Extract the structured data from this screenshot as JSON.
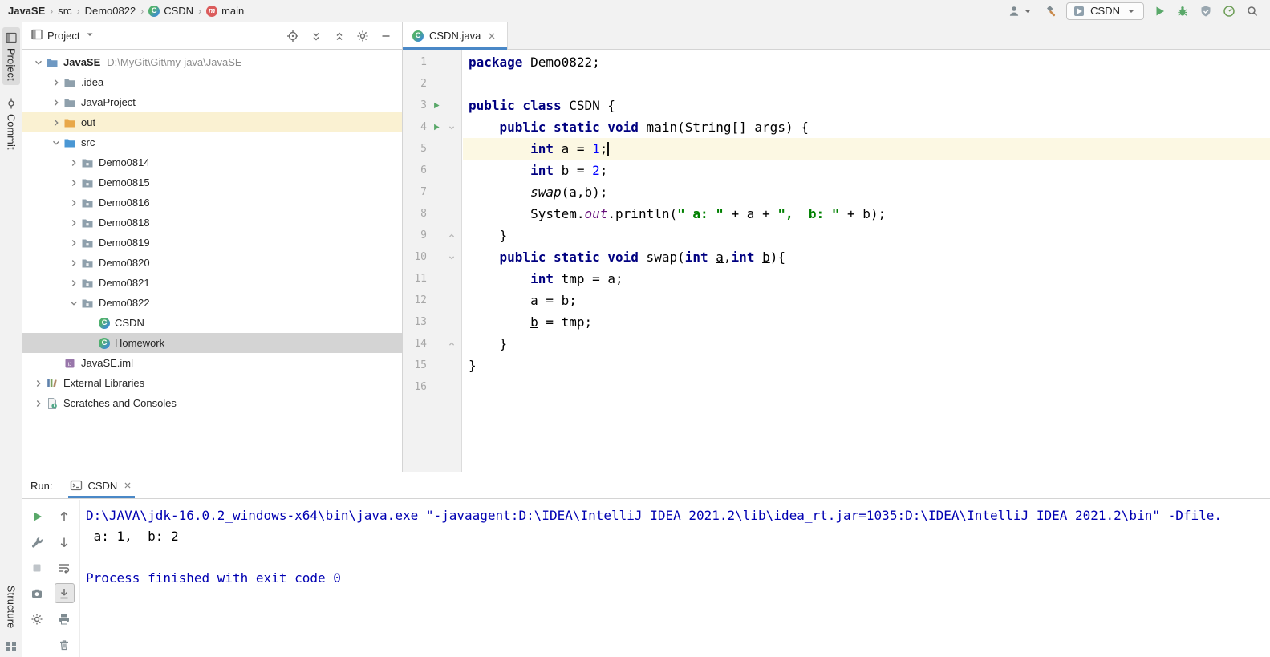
{
  "colors": {
    "accent_blue": "#4A88C7",
    "keyword": "#000080",
    "number": "#0000FF",
    "string": "#008000",
    "static_field": "#660E7A",
    "console_system": "#0000B2",
    "run_green": "#59A869",
    "caret_line": "#FCF8E3",
    "selection_gray": "#D4D4D4",
    "excluded_row_yellow": "#FAF1D2"
  },
  "breadcrumbs": {
    "separator": "›",
    "items": [
      {
        "label": "JavaSE",
        "bold": true
      },
      {
        "label": "src"
      },
      {
        "label": "Demo0822"
      },
      {
        "label": "CSDN",
        "icon": "class"
      },
      {
        "label": "main",
        "icon": "method"
      }
    ]
  },
  "top_toolbar": {
    "left_icons": [
      "user",
      "hammer"
    ],
    "run_config": {
      "label": "CSDN",
      "icon": "app-config"
    },
    "action_icons": [
      "run",
      "debug",
      "coverage",
      "profiler",
      "search"
    ]
  },
  "left_stripe": {
    "tabs": [
      {
        "label": "Project",
        "icon": "tool-window",
        "active": true
      },
      {
        "label": "Commit",
        "icon": "commit"
      }
    ],
    "bottom_tab": {
      "label": "Structure"
    }
  },
  "project_panel": {
    "title": "Project",
    "header_icons": [
      "target",
      "expand-all",
      "collapse-all",
      "gear",
      "minimize"
    ],
    "tree": [
      {
        "label": "JavaSE",
        "path": "D:\\MyGit\\Git\\my-java\\JavaSE",
        "level": 0,
        "chevron": "down",
        "icon": "folder-root",
        "bold": true
      },
      {
        "label": ".idea",
        "level": 1,
        "chevron": "right",
        "icon": "folder"
      },
      {
        "label": "JavaProject",
        "level": 1,
        "chevron": "right",
        "icon": "folder"
      },
      {
        "label": "out",
        "level": 1,
        "chevron": "right",
        "icon": "folder-out",
        "state": "highlighted"
      },
      {
        "label": "src",
        "level": 1,
        "chevron": "down",
        "icon": "folder-src"
      },
      {
        "label": "Demo0814",
        "level": 2,
        "chevron": "right",
        "icon": "package"
      },
      {
        "label": "Demo0815",
        "level": 2,
        "chevron": "right",
        "icon": "package"
      },
      {
        "label": "Demo0816",
        "level": 2,
        "chevron": "right",
        "icon": "package"
      },
      {
        "label": "Demo0818",
        "level": 2,
        "chevron": "right",
        "icon": "package"
      },
      {
        "label": "Demo0819",
        "level": 2,
        "chevron": "right",
        "icon": "package"
      },
      {
        "label": "Demo0820",
        "level": 2,
        "chevron": "right",
        "icon": "package"
      },
      {
        "label": "Demo0821",
        "level": 2,
        "chevron": "right",
        "icon": "package"
      },
      {
        "label": "Demo0822",
        "level": 2,
        "chevron": "down",
        "icon": "package"
      },
      {
        "label": "CSDN",
        "level": 3,
        "icon": "class"
      },
      {
        "label": "Homework",
        "level": 3,
        "icon": "class",
        "state": "selected"
      },
      {
        "label": "JavaSE.iml",
        "level": 1,
        "icon": "file-iml"
      },
      {
        "label": "External Libraries",
        "level": 0,
        "chevron": "right",
        "icon": "library"
      },
      {
        "label": "Scratches and Consoles",
        "level": 0,
        "chevron": "right",
        "icon": "scratches"
      }
    ]
  },
  "editor": {
    "tab": {
      "label": "CSDN.java",
      "icon": "class"
    },
    "lines": [
      {
        "n": 1,
        "seg": [
          {
            "t": "package",
            "c": "k"
          },
          {
            "t": " Demo0822;",
            "c": "p"
          }
        ]
      },
      {
        "n": 2,
        "seg": []
      },
      {
        "n": 3,
        "run": true,
        "seg": [
          {
            "t": "public class",
            "c": "k"
          },
          {
            "t": " CSDN {",
            "c": "p"
          }
        ]
      },
      {
        "n": 4,
        "run": true,
        "fold": "start",
        "seg": [
          {
            "t": "    ",
            "c": "p"
          },
          {
            "t": "public static void",
            "c": "k"
          },
          {
            "t": " main(String[] args) {",
            "c": "p"
          }
        ]
      },
      {
        "n": 5,
        "current": true,
        "seg": [
          {
            "t": "        ",
            "c": "p"
          },
          {
            "t": "int",
            "c": "k"
          },
          {
            "t": " a = ",
            "c": "p"
          },
          {
            "t": "1",
            "c": "n"
          },
          {
            "t": ";",
            "c": "p"
          },
          {
            "caret": true
          }
        ]
      },
      {
        "n": 6,
        "seg": [
          {
            "t": "        ",
            "c": "p"
          },
          {
            "t": "int",
            "c": "k"
          },
          {
            "t": " b = ",
            "c": "p"
          },
          {
            "t": "2",
            "c": "n"
          },
          {
            "t": ";",
            "c": "p"
          }
        ]
      },
      {
        "n": 7,
        "seg": [
          {
            "t": "        ",
            "c": "p"
          },
          {
            "t": "swap",
            "c": "m"
          },
          {
            "t": "(a,b);",
            "c": "p"
          }
        ]
      },
      {
        "n": 8,
        "seg": [
          {
            "t": "        System.",
            "c": "p"
          },
          {
            "t": "out",
            "c": "f"
          },
          {
            "t": ".println(",
            "c": "p"
          },
          {
            "t": "\" a: \"",
            "c": "s"
          },
          {
            "t": " + a + ",
            "c": "p"
          },
          {
            "t": "\",  b: \"",
            "c": "s"
          },
          {
            "t": " + b);",
            "c": "p"
          }
        ]
      },
      {
        "n": 9,
        "fold": "end",
        "seg": [
          {
            "t": "    }",
            "c": "p"
          }
        ]
      },
      {
        "n": 10,
        "fold": "start",
        "seg": [
          {
            "t": "    ",
            "c": "p"
          },
          {
            "t": "public static void",
            "c": "k"
          },
          {
            "t": " swap(",
            "c": "p"
          },
          {
            "t": "int",
            "c": "k"
          },
          {
            "t": " ",
            "c": "p"
          },
          {
            "t": "a",
            "c": "u"
          },
          {
            "t": ",",
            "c": "p"
          },
          {
            "t": "int",
            "c": "k"
          },
          {
            "t": " ",
            "c": "p"
          },
          {
            "t": "b",
            "c": "u"
          },
          {
            "t": "){",
            "c": "p"
          }
        ]
      },
      {
        "n": 11,
        "seg": [
          {
            "t": "        ",
            "c": "p"
          },
          {
            "t": "int",
            "c": "k"
          },
          {
            "t": " tmp = a;",
            "c": "p"
          }
        ]
      },
      {
        "n": 12,
        "seg": [
          {
            "t": "        ",
            "c": "p"
          },
          {
            "t": "a",
            "c": "u"
          },
          {
            "t": " = b;",
            "c": "p"
          }
        ]
      },
      {
        "n": 13,
        "seg": [
          {
            "t": "        ",
            "c": "p"
          },
          {
            "t": "b",
            "c": "u"
          },
          {
            "t": " = tmp;",
            "c": "p"
          }
        ]
      },
      {
        "n": 14,
        "fold": "end",
        "seg": [
          {
            "t": "    }",
            "c": "p"
          }
        ]
      },
      {
        "n": 15,
        "seg": [
          {
            "t": "}",
            "c": "p"
          }
        ]
      },
      {
        "n": 16,
        "seg": []
      }
    ]
  },
  "run_panel": {
    "label": "Run:",
    "tab": {
      "label": "CSDN",
      "icon": "console"
    },
    "toolbar_left": [
      "rerun",
      "wrench",
      "stop",
      "camera",
      "settings"
    ],
    "toolbar_right": [
      "up-arrow",
      "down-arrow",
      "soft-wrap",
      {
        "icon": "scroll-end",
        "pressed": true
      },
      "print",
      "clear"
    ],
    "console": [
      {
        "c": "sys",
        "t": "D:\\JAVA\\jdk-16.0.2_windows-x64\\bin\\java.exe \"-javaagent:D:\\IDEA\\IntelliJ IDEA 2021.2\\lib\\idea_rt.jar=1035:D:\\IDEA\\IntelliJ IDEA 2021.2\\bin\" -Dfile."
      },
      {
        "c": "out",
        "t": " a: 1,  b: 2"
      },
      {
        "c": "out",
        "t": ""
      },
      {
        "c": "sys",
        "t": "Process finished with exit code 0"
      }
    ]
  }
}
